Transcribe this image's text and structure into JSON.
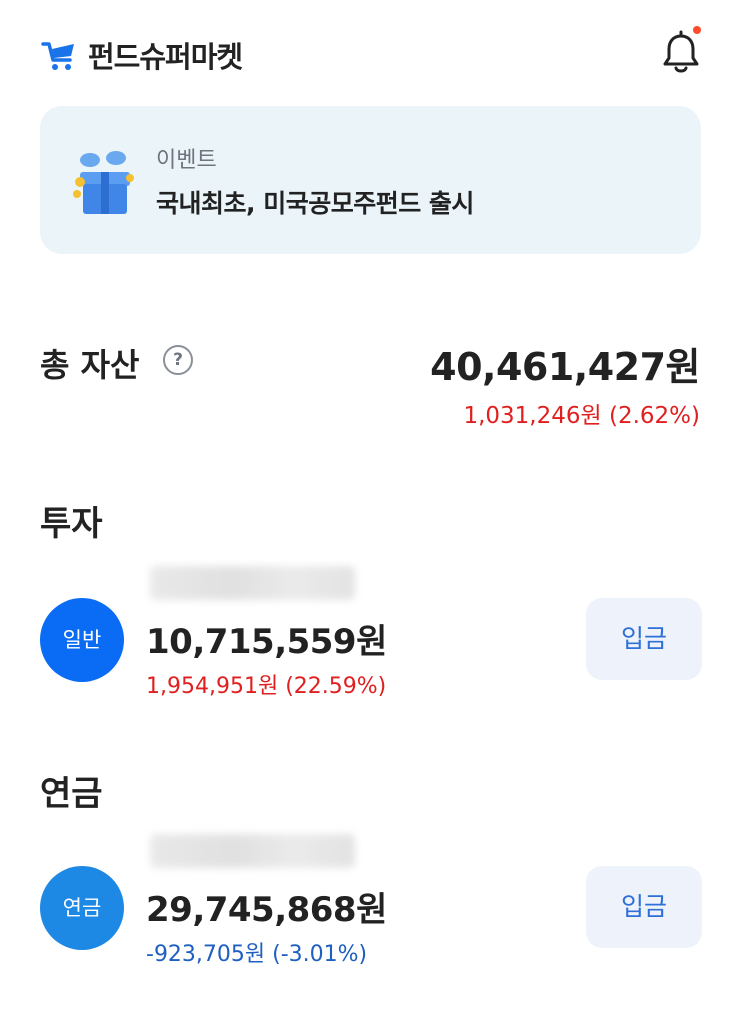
{
  "header": {
    "app_name": "펀드슈퍼마켓",
    "logo_icon": "cart-icon",
    "notification_icon": "bell-icon",
    "has_unread_notification": true,
    "brand_color": "#1a73e8"
  },
  "event": {
    "tag": "이벤트",
    "title": "국내최초, 미국공모주펀드 출시",
    "icon": "gift-box-icon"
  },
  "total_assets": {
    "label": "총 자산",
    "help_icon_text": "?",
    "amount": "40,461,427원",
    "change": "1,031,246원 (2.62%)",
    "change_color": "#e02020"
  },
  "investment": {
    "section_title": "투자",
    "account": {
      "badge": "일반",
      "badge_color": "#0a6cf5",
      "amount": "10,715,559원",
      "change": "1,954,951원 (22.59%)",
      "change_color": "#e02020",
      "deposit_label": "입금"
    }
  },
  "pension": {
    "section_title": "연금",
    "account": {
      "badge": "연금",
      "badge_color": "#1e88e5",
      "amount": "29,745,868원",
      "change": "-923,705원 (-3.01%)",
      "change_color": "#1e5fc0",
      "deposit_label": "입금"
    }
  }
}
